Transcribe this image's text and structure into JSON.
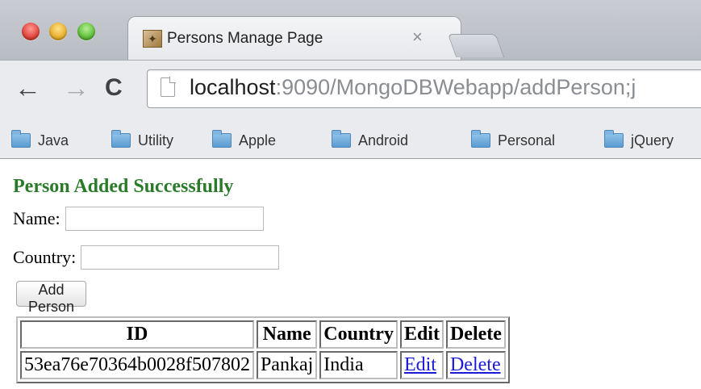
{
  "browser": {
    "tab_title": "Persons Manage Page",
    "tab_close_glyph": "×",
    "url_host": "localhost",
    "url_rest": ":9090/MongoDBWebapp/addPerson;j",
    "nav": {
      "back_glyph": "←",
      "forward_glyph": "→",
      "reload_glyph": "C"
    },
    "bookmarks": [
      "Java",
      "Utility",
      "Apple",
      "Android",
      "Personal",
      "jQuery"
    ]
  },
  "page": {
    "message": "Person Added Successfully",
    "name_label": "Name:",
    "name_value": "",
    "country_label": "Country:",
    "country_value": "",
    "add_button": "Add Person",
    "table": {
      "headers": [
        "ID",
        "Name",
        "Country",
        "Edit",
        "Delete"
      ],
      "rows": [
        {
          "id": "53ea76e70364b0028f507802",
          "name": "Pankaj",
          "country": "India",
          "edit": "Edit",
          "delete": "Delete"
        }
      ]
    }
  },
  "colors": {
    "success": "#2a7a2a",
    "link": "#1a1ad8"
  },
  "icons": [
    "close-icon",
    "back-icon",
    "forward-icon",
    "reload-icon",
    "page-icon",
    "folder-icon",
    "favicon-icon"
  ]
}
